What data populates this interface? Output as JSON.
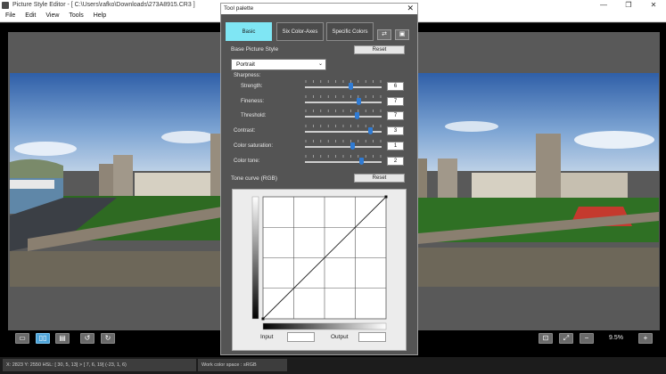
{
  "window": {
    "title": "Picture Style Editor - [ C:\\Users\\rafko\\Downloads\\273A8915.CR3 ]",
    "controls": [
      "—",
      "❐",
      "✕"
    ]
  },
  "menu": [
    "File",
    "Edit",
    "View",
    "Tools",
    "Help"
  ],
  "toolbar": {
    "buttons": [
      "single-view",
      "split-view",
      "grid-view",
      "rotate-left",
      "rotate-right"
    ],
    "right_buttons": [
      "fit-screen",
      "fullscreen",
      "zoom-out",
      "zoom-in"
    ],
    "zoom": "9.5%"
  },
  "status": {
    "info": "X: 2823 Y: 2550  HSL: [ 30,  5, 13] > [  7,  6, 19]  (-23,  1,  6)",
    "color_space": "Work color space : sRGB"
  },
  "palette": {
    "title": "Tool palette",
    "close": "✕",
    "tabs": [
      "Basic",
      "Six Color-Axes",
      "Specific Colors"
    ],
    "active_tab": "Basic",
    "base_style_label": "Base Picture Style",
    "reset_label": "Reset",
    "base_style_value": "Portrait",
    "sharpness_label": "Sharpness:",
    "sliders": [
      {
        "label": "Strength:",
        "value": "6",
        "level": 0.6
      },
      {
        "label": "Fineness:",
        "value": "7",
        "level": 0.7
      },
      {
        "label": "Threshold:",
        "value": "7",
        "level": 0.68
      },
      {
        "label": "Contrast:",
        "value": "3",
        "level": 0.86
      },
      {
        "label": "Color saturation:",
        "value": "1",
        "level": 0.62
      },
      {
        "label": "Color tone:",
        "value": "2",
        "level": 0.74
      }
    ],
    "tone_curve_label": "Tone curve (RGB)",
    "input_label": "Input",
    "output_label": "Output"
  },
  "colors": {
    "active_tab": "#7fe6f4",
    "slider_thumb": "#2f7bd4",
    "active_toolbar_button": "#4da3d8"
  }
}
